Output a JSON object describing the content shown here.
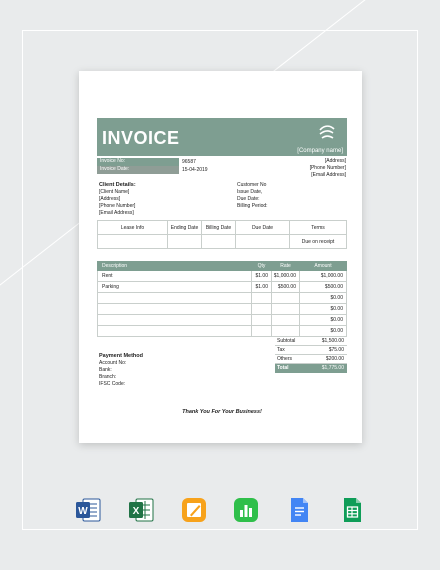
{
  "invoice": {
    "title": "INVOICE",
    "company_name": "[Company name]",
    "company_address": [
      "[Address]",
      "[Phone Number]",
      "[Email Address]"
    ],
    "meta": [
      {
        "label": "Invoice No:",
        "value": "96587"
      },
      {
        "label": "Invoice Date:",
        "value": "15-04-2019"
      }
    ],
    "client": {
      "heading": "Client Details:",
      "lines": [
        "[Client Name]",
        "[Address]",
        "[Phone Number]",
        "[Email Address]"
      ],
      "right_fields": [
        "Customer No",
        "Issue Date,",
        "Due Date:",
        "Billing Period:"
      ]
    },
    "lease_table": {
      "headers": [
        "Lease Info",
        "Ending Date",
        "Billing Date",
        "Due Date",
        "Terms"
      ],
      "row": [
        "",
        "",
        "",
        "",
        "Due on receipt"
      ]
    },
    "items_table": {
      "headers": [
        "Description",
        "Qty",
        "Rate",
        "Amount"
      ],
      "rows": [
        [
          "Rent",
          "$1.00",
          "$1,000.00",
          "$1,000.00"
        ],
        [
          "Parking",
          "$1.00",
          "$500.00",
          "$500.00"
        ],
        [
          "",
          "",
          "",
          "$0.00"
        ],
        [
          "",
          "",
          "",
          "$0.00"
        ],
        [
          "",
          "",
          "",
          "$0.00"
        ],
        [
          "",
          "",
          "",
          "$0.00"
        ]
      ]
    },
    "summary": [
      {
        "label": "Subtotal",
        "value": "$1,500.00"
      },
      {
        "label": "Tax",
        "value": "$75.00"
      },
      {
        "label": "Others",
        "value": "$200.00"
      },
      {
        "label": "Total",
        "value": "$1,775.00"
      }
    ],
    "payment": {
      "heading": "Payment Method",
      "fields": [
        "Account No:",
        "Bank:",
        "Branch:",
        "IFSC Code:"
      ]
    },
    "thanks": "Thank You For Your Business!"
  },
  "colors": {
    "accent": "#7e9e91",
    "background": "#e9ebec"
  },
  "app_icons": [
    {
      "name": "word-icon",
      "letter": "W",
      "color": "#2b579a"
    },
    {
      "name": "excel-icon",
      "letter": "X",
      "color": "#217346"
    },
    {
      "name": "pages-icon",
      "letter": "",
      "color": "#f5a623"
    },
    {
      "name": "numbers-icon",
      "letter": "",
      "color": "#2fbf4a"
    },
    {
      "name": "google-docs-icon",
      "letter": "",
      "color": "#4285f4"
    },
    {
      "name": "google-sheets-icon",
      "letter": "",
      "color": "#0f9d58"
    }
  ]
}
